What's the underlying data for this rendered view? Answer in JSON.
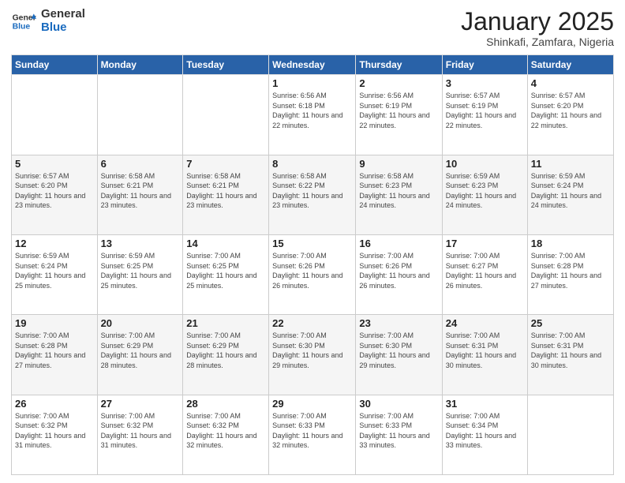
{
  "header": {
    "logo_general": "General",
    "logo_blue": "Blue",
    "title": "January 2025",
    "subtitle": "Shinkafi, Zamfara, Nigeria"
  },
  "calendar": {
    "days_of_week": [
      "Sunday",
      "Monday",
      "Tuesday",
      "Wednesday",
      "Thursday",
      "Friday",
      "Saturday"
    ],
    "weeks": [
      [
        {
          "day": "",
          "info": ""
        },
        {
          "day": "",
          "info": ""
        },
        {
          "day": "",
          "info": ""
        },
        {
          "day": "1",
          "info": "Sunrise: 6:56 AM\nSunset: 6:18 PM\nDaylight: 11 hours and 22 minutes."
        },
        {
          "day": "2",
          "info": "Sunrise: 6:56 AM\nSunset: 6:19 PM\nDaylight: 11 hours and 22 minutes."
        },
        {
          "day": "3",
          "info": "Sunrise: 6:57 AM\nSunset: 6:19 PM\nDaylight: 11 hours and 22 minutes."
        },
        {
          "day": "4",
          "info": "Sunrise: 6:57 AM\nSunset: 6:20 PM\nDaylight: 11 hours and 22 minutes."
        }
      ],
      [
        {
          "day": "5",
          "info": "Sunrise: 6:57 AM\nSunset: 6:20 PM\nDaylight: 11 hours and 23 minutes."
        },
        {
          "day": "6",
          "info": "Sunrise: 6:58 AM\nSunset: 6:21 PM\nDaylight: 11 hours and 23 minutes."
        },
        {
          "day": "7",
          "info": "Sunrise: 6:58 AM\nSunset: 6:21 PM\nDaylight: 11 hours and 23 minutes."
        },
        {
          "day": "8",
          "info": "Sunrise: 6:58 AM\nSunset: 6:22 PM\nDaylight: 11 hours and 23 minutes."
        },
        {
          "day": "9",
          "info": "Sunrise: 6:58 AM\nSunset: 6:23 PM\nDaylight: 11 hours and 24 minutes."
        },
        {
          "day": "10",
          "info": "Sunrise: 6:59 AM\nSunset: 6:23 PM\nDaylight: 11 hours and 24 minutes."
        },
        {
          "day": "11",
          "info": "Sunrise: 6:59 AM\nSunset: 6:24 PM\nDaylight: 11 hours and 24 minutes."
        }
      ],
      [
        {
          "day": "12",
          "info": "Sunrise: 6:59 AM\nSunset: 6:24 PM\nDaylight: 11 hours and 25 minutes."
        },
        {
          "day": "13",
          "info": "Sunrise: 6:59 AM\nSunset: 6:25 PM\nDaylight: 11 hours and 25 minutes."
        },
        {
          "day": "14",
          "info": "Sunrise: 7:00 AM\nSunset: 6:25 PM\nDaylight: 11 hours and 25 minutes."
        },
        {
          "day": "15",
          "info": "Sunrise: 7:00 AM\nSunset: 6:26 PM\nDaylight: 11 hours and 26 minutes."
        },
        {
          "day": "16",
          "info": "Sunrise: 7:00 AM\nSunset: 6:26 PM\nDaylight: 11 hours and 26 minutes."
        },
        {
          "day": "17",
          "info": "Sunrise: 7:00 AM\nSunset: 6:27 PM\nDaylight: 11 hours and 26 minutes."
        },
        {
          "day": "18",
          "info": "Sunrise: 7:00 AM\nSunset: 6:28 PM\nDaylight: 11 hours and 27 minutes."
        }
      ],
      [
        {
          "day": "19",
          "info": "Sunrise: 7:00 AM\nSunset: 6:28 PM\nDaylight: 11 hours and 27 minutes."
        },
        {
          "day": "20",
          "info": "Sunrise: 7:00 AM\nSunset: 6:29 PM\nDaylight: 11 hours and 28 minutes."
        },
        {
          "day": "21",
          "info": "Sunrise: 7:00 AM\nSunset: 6:29 PM\nDaylight: 11 hours and 28 minutes."
        },
        {
          "day": "22",
          "info": "Sunrise: 7:00 AM\nSunset: 6:30 PM\nDaylight: 11 hours and 29 minutes."
        },
        {
          "day": "23",
          "info": "Sunrise: 7:00 AM\nSunset: 6:30 PM\nDaylight: 11 hours and 29 minutes."
        },
        {
          "day": "24",
          "info": "Sunrise: 7:00 AM\nSunset: 6:31 PM\nDaylight: 11 hours and 30 minutes."
        },
        {
          "day": "25",
          "info": "Sunrise: 7:00 AM\nSunset: 6:31 PM\nDaylight: 11 hours and 30 minutes."
        }
      ],
      [
        {
          "day": "26",
          "info": "Sunrise: 7:00 AM\nSunset: 6:32 PM\nDaylight: 11 hours and 31 minutes."
        },
        {
          "day": "27",
          "info": "Sunrise: 7:00 AM\nSunset: 6:32 PM\nDaylight: 11 hours and 31 minutes."
        },
        {
          "day": "28",
          "info": "Sunrise: 7:00 AM\nSunset: 6:32 PM\nDaylight: 11 hours and 32 minutes."
        },
        {
          "day": "29",
          "info": "Sunrise: 7:00 AM\nSunset: 6:33 PM\nDaylight: 11 hours and 32 minutes."
        },
        {
          "day": "30",
          "info": "Sunrise: 7:00 AM\nSunset: 6:33 PM\nDaylight: 11 hours and 33 minutes."
        },
        {
          "day": "31",
          "info": "Sunrise: 7:00 AM\nSunset: 6:34 PM\nDaylight: 11 hours and 33 minutes."
        },
        {
          "day": "",
          "info": ""
        }
      ]
    ]
  }
}
